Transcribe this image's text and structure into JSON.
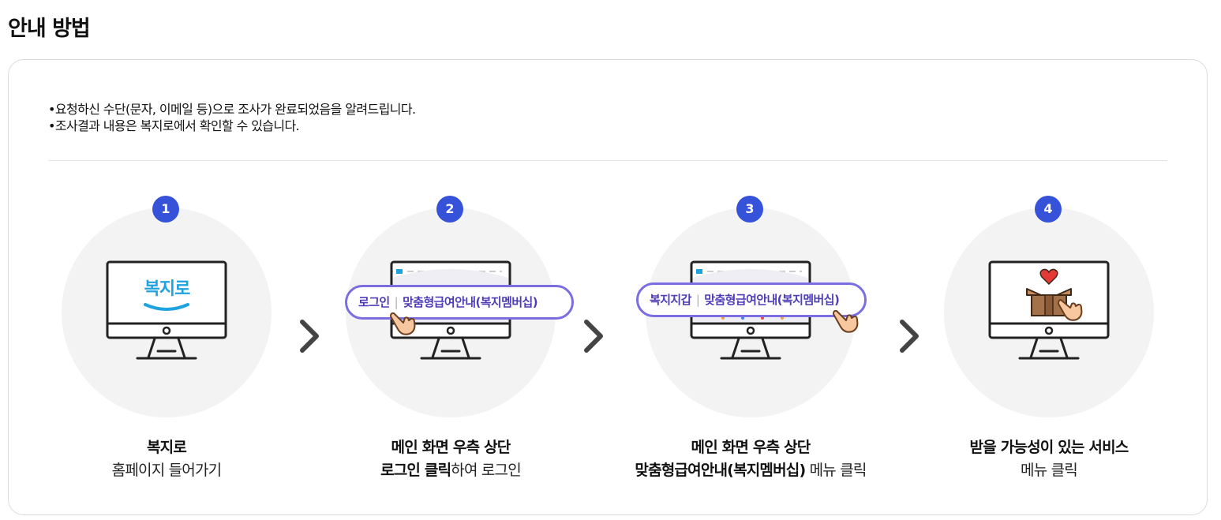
{
  "page": {
    "title": "안내 방법"
  },
  "notes": [
    "•요청하신 수단(문자, 이메일 등)으로 조사가 완료되었음을 알려드립니다.",
    "•조사결과 내용은 복지로에서 확인할 수 있습니다."
  ],
  "steps": [
    {
      "number": "1",
      "logo_text": "복지로",
      "caption_bold": "복지로",
      "caption_rest": "홈페이지 들어가기"
    },
    {
      "number": "2",
      "pill_left": "로그인",
      "pill_right": "맞춤형급여안내(복지멤버십)",
      "caption_line1": "메인 화면 우측 상단",
      "caption_bold": "로그인 클릭",
      "caption_rest": "하여 로그인"
    },
    {
      "number": "3",
      "pill_left": "복지지갑",
      "pill_right": "맞춤형급여안내(복지멤버십)",
      "caption_line1": "메인 화면 우측 상단",
      "caption_bold": "맞춤형급여안내(복지멤버십)",
      "caption_rest": " 메뉴 클릭"
    },
    {
      "number": "4",
      "caption_bold": "받을 가능성이 있는 서비스",
      "caption_rest": "메뉴 클릭"
    }
  ],
  "icons": {
    "arrow": "chevron-right-icon",
    "monitor": "monitor-icon",
    "hand": "pointing-hand-icon",
    "box": "gift-box-icon",
    "heart": "heart-icon"
  },
  "colors": {
    "accent": "#3552d8",
    "pill_border": "#7b6ee0",
    "pill_text": "#4e3db7",
    "circle_bg": "#f3f3f3"
  }
}
